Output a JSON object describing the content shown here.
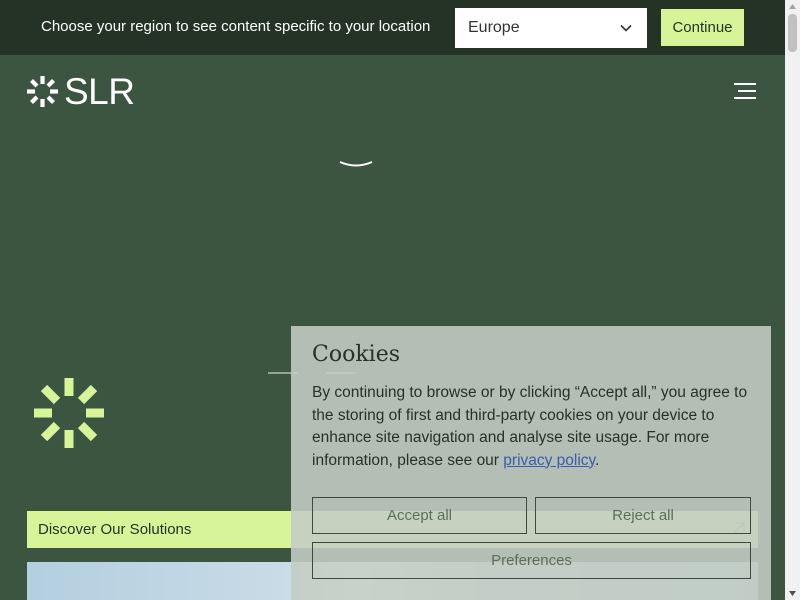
{
  "region_bar": {
    "prompt": "Choose your region to see content specific to your location",
    "selected_region": "Europe",
    "continue_label": "Continue"
  },
  "header": {
    "logo_text": "SLR",
    "menu_icon": "hamburger-icon"
  },
  "hero": {
    "discover_label": "Discover Our Solutions",
    "discover_icon": "arrow-up-right-icon"
  },
  "cookie_banner": {
    "title": "Cookies",
    "body": "By continuing to browse or by clicking “Accept all,” you agree to the storing of first and third-party cookies on your device to enhance site navigation and analyse site usage. For more information, please see our ",
    "link_text": "privacy policy",
    "body_end": ".",
    "accept_label": "Accept all",
    "reject_label": "Reject all",
    "preferences_label": "Preferences"
  },
  "colors": {
    "background": "#3c5540",
    "region_bar": "#253326",
    "accent": "#d7f598",
    "cookie_bg": "#c4cdc4",
    "link": "#3c5bb0"
  }
}
